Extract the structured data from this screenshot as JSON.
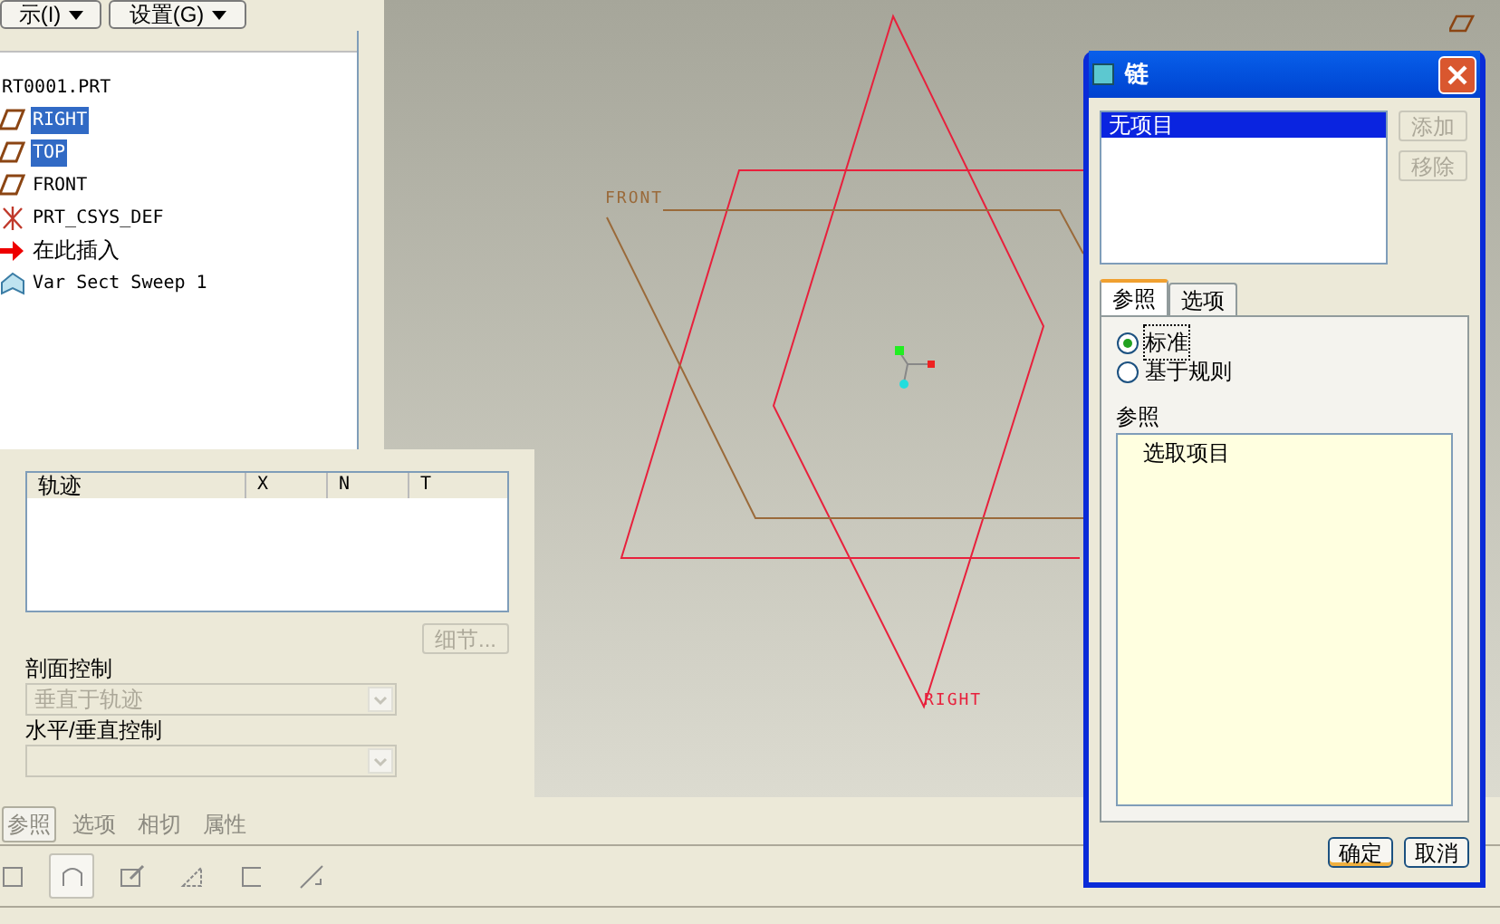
{
  "header_buttons": [
    {
      "label": "示(I)"
    },
    {
      "label": "设置(G)"
    }
  ],
  "model_tree": {
    "items": [
      {
        "kind": "part",
        "label": "RT0001.PRT",
        "selected": false
      },
      {
        "kind": "plane",
        "label": "RIGHT",
        "selected": true
      },
      {
        "kind": "plane",
        "label": "TOP",
        "selected": true
      },
      {
        "kind": "plane",
        "label": "FRONT",
        "selected": false
      },
      {
        "kind": "csys",
        "label": "PRT_CSYS_DEF",
        "selected": false
      },
      {
        "kind": "insert",
        "label": "在此插入",
        "selected": false
      },
      {
        "kind": "sweep",
        "label": "Var Sect Sweep 1",
        "selected": false
      }
    ]
  },
  "references_panel": {
    "table": {
      "columns": [
        "轨迹",
        "X",
        "N",
        "T"
      ]
    },
    "details_button": {
      "label": "细节...",
      "disabled": true
    },
    "section_control": {
      "label": "剖面控制",
      "value": "垂直于轨迹",
      "disabled": true
    },
    "horizontal_vertical_control": {
      "label": "水平/垂直控制",
      "disabled": true
    }
  },
  "dashboard_tabs": [
    {
      "label": "参照",
      "selected": true
    },
    {
      "label": "选项",
      "selected": false
    },
    {
      "label": "相切",
      "selected": false
    },
    {
      "label": "属性",
      "selected": false
    }
  ],
  "toolbar": [
    {
      "kind": "partial",
      "selected": false
    },
    {
      "kind": "sweep",
      "selected": true
    },
    {
      "kind": "sketch",
      "selected": false
    },
    {
      "kind": "surface",
      "selected": false
    },
    {
      "kind": "open",
      "selected": false
    },
    {
      "kind": "draft",
      "selected": false
    }
  ],
  "canvas": {
    "labels": [
      {
        "kind": "front",
        "text": "FRONT"
      },
      {
        "kind": "right",
        "text": "RIGHT"
      }
    ]
  },
  "dialog": {
    "title": "链",
    "items": [
      {
        "label": "无项目",
        "selected": true
      }
    ],
    "side_buttons": [
      {
        "label": "添加",
        "disabled": true
      },
      {
        "label": "移除",
        "disabled": true
      }
    ],
    "tabs": [
      {
        "label": "参照",
        "selected": true
      },
      {
        "label": "选项",
        "selected": false
      }
    ],
    "radios": [
      {
        "label": "标准",
        "selected": true
      },
      {
        "label": "基于规则",
        "selected": false
      }
    ],
    "references_label": "参照",
    "references_hint": "选取项目",
    "buttons": [
      {
        "label": "确定"
      },
      {
        "label": "取消"
      }
    ]
  }
}
